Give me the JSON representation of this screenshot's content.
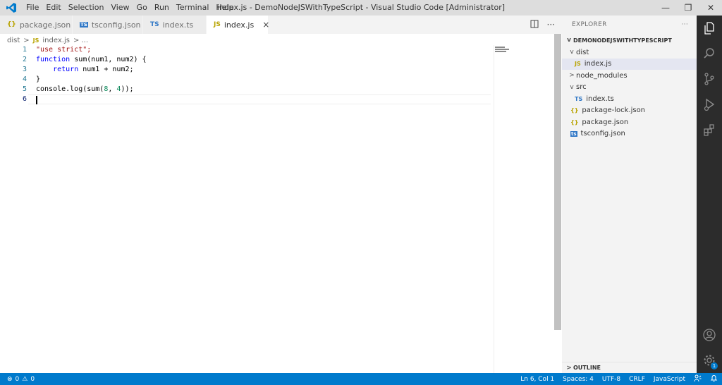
{
  "menu": [
    "File",
    "Edit",
    "Selection",
    "View",
    "Go",
    "Run",
    "Terminal",
    "Help"
  ],
  "window_title": "index.js - DemoNodeJSWithTypeScript - Visual Studio Code [Administrator]",
  "tabs": [
    {
      "icon": "{}",
      "label": "package.json"
    },
    {
      "icon": "TS",
      "label": "tsconfig.json"
    },
    {
      "icon": "TS",
      "label": "index.ts"
    },
    {
      "icon": "JS",
      "label": "index.js",
      "close": "×"
    }
  ],
  "breadcrumb": {
    "folder": "dist",
    "sep": ">",
    "file_icon": "JS",
    "file": "index.js",
    "tail": "> ..."
  },
  "editor": {
    "line_numbers": [
      "1",
      "2",
      "3",
      "4",
      "5",
      "6"
    ],
    "lines": {
      "l1": "\"use strict\";",
      "l2_kw": "function",
      "l2_rest": " sum(num1, num2) {",
      "l3_indent": "    ",
      "l3_kw": "return",
      "l3_rest": " num1 + num2;",
      "l4": "}",
      "l5_a": "console.log(sum(",
      "l5_n1": "8",
      "l5_b": ", ",
      "l5_n2": "4",
      "l5_c": "));"
    }
  },
  "explorer": {
    "header": "EXPLORER",
    "more": "···",
    "project": "DEMONODEJSWITHTYPESCRIPT",
    "items": [
      {
        "chevron": "v",
        "icon": "",
        "label": "dist"
      },
      {
        "chevron": "",
        "icon": "JS",
        "label": "index.js"
      },
      {
        "chevron": ">",
        "icon": "",
        "label": "node_modules"
      },
      {
        "chevron": "v",
        "icon": "",
        "label": "src"
      },
      {
        "chevron": "",
        "icon": "TS",
        "label": "index.ts"
      },
      {
        "chevron": "",
        "icon": "{}",
        "label": "package-lock.json"
      },
      {
        "chevron": "",
        "icon": "{}",
        "label": "package.json"
      },
      {
        "chevron": "",
        "icon": "ts",
        "label": "tsconfig.json"
      }
    ],
    "outline": "OUTLINE"
  },
  "status": {
    "errors": "0",
    "warnings": "0",
    "position": "Ln 6, Col 1",
    "spaces": "Spaces: 4",
    "encoding": "UTF-8",
    "eol": "CRLF",
    "language": "JavaScript"
  },
  "settings_badge": "1",
  "colors": {
    "status_bar": "#007acc",
    "activity_bar": "#2c2c2c",
    "title_bar": "#dddddd"
  }
}
